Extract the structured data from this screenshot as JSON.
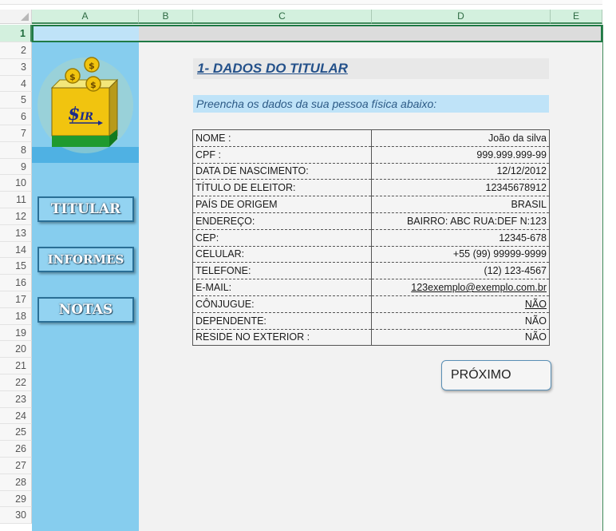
{
  "columns": [
    "A",
    "B",
    "C",
    "D",
    "E"
  ],
  "rows": [
    "1",
    "2",
    "3",
    "4",
    "5",
    "6",
    "7",
    "8",
    "9",
    "10",
    "11",
    "12",
    "13",
    "14",
    "15",
    "16",
    "17",
    "18",
    "19",
    "20",
    "21",
    "22",
    "23",
    "24",
    "25",
    "26",
    "27",
    "28",
    "29",
    "30"
  ],
  "logo": {
    "text": "$IR",
    "coin_symbol": "$"
  },
  "nav": {
    "titular": "TITULAR",
    "informes": "INFORMES",
    "notas": "NOTAS"
  },
  "section_title": "1- DADOS DO TITULAR",
  "subtitle": "Preencha os dados da sua pessoa física abaixo:",
  "fields": [
    {
      "label": "NOME :",
      "value": "João da silva"
    },
    {
      "label": "CPF :",
      "value": "999.999.999-99"
    },
    {
      "label": "DATA DE NASCIMENTO:",
      "value": "12/12/2012"
    },
    {
      "label": "TÍTULO DE ELEITOR:",
      "value": "12345678912"
    },
    {
      "label": "PAÍS DE ORIGEM",
      "value": "BRASIL"
    },
    {
      "label": "ENDEREÇO:",
      "value": "BAIRRO: ABC RUA:DEF N:123"
    },
    {
      "label": "CEP:",
      "value": "12345-678"
    },
    {
      "label": "CELULAR:",
      "value": "+55 (99) 99999-9999"
    },
    {
      "label": "TELEFONE:",
      "value": "(12) 123-4567"
    },
    {
      "label": "E-MAIL:",
      "value": "123exemplo@exemplo.com.br"
    },
    {
      "label": "CÔNJUGUE:",
      "value": "NÃO"
    },
    {
      "label": "DEPENDENTE:",
      "value": "NÃO"
    },
    {
      "label": "RESIDE NO EXTERIOR :",
      "value": "NÃO"
    }
  ],
  "next_button": "PRÓXIMO",
  "colors": {
    "sidebar": "#86cdee",
    "header_green": "#d3f0de",
    "title_blue": "#24518a"
  }
}
